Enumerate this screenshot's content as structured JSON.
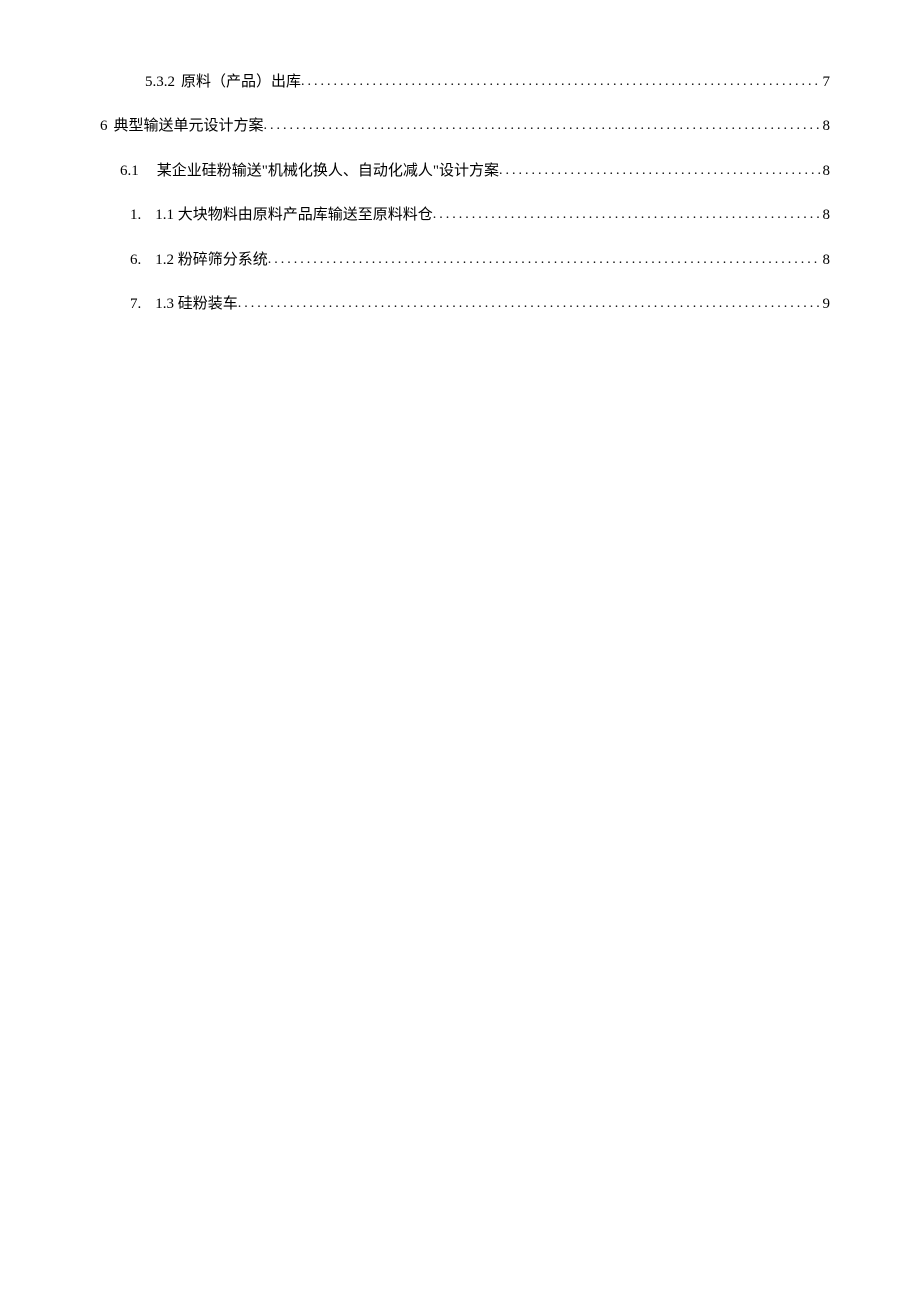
{
  "toc": {
    "entries": [
      {
        "indentClass": "indent-3",
        "prefix": "5.3.2",
        "prefixGap": "gap-small",
        "title": "原料（产品）出库",
        "page": "7"
      },
      {
        "indentClass": "indent-1",
        "prefix": "6",
        "prefixGap": "gap-small",
        "title": "典型输送单元设计方案 ",
        "page": "8"
      },
      {
        "indentClass": "indent-2",
        "prefix": "6.1",
        "prefixGap": "gap-med",
        "title": "某企业硅粉输送\"机械化换人、自动化减人\"设计方案",
        "page": "8"
      },
      {
        "indentClass": "indent-2b",
        "prefix": "1.",
        "prefixGap": "gap-tab",
        "title": "1.1 大块物料由原料产品库输送至原料料仓 ",
        "page": "8"
      },
      {
        "indentClass": "indent-2b",
        "prefix": "6.",
        "prefixGap": "gap-tab",
        "title": "1.2 粉碎筛分系统 ",
        "page": "8"
      },
      {
        "indentClass": "indent-2b",
        "prefix": "7.",
        "prefixGap": "gap-tab",
        "title": "1.3 硅粉装车 ",
        "page": "9"
      }
    ]
  }
}
